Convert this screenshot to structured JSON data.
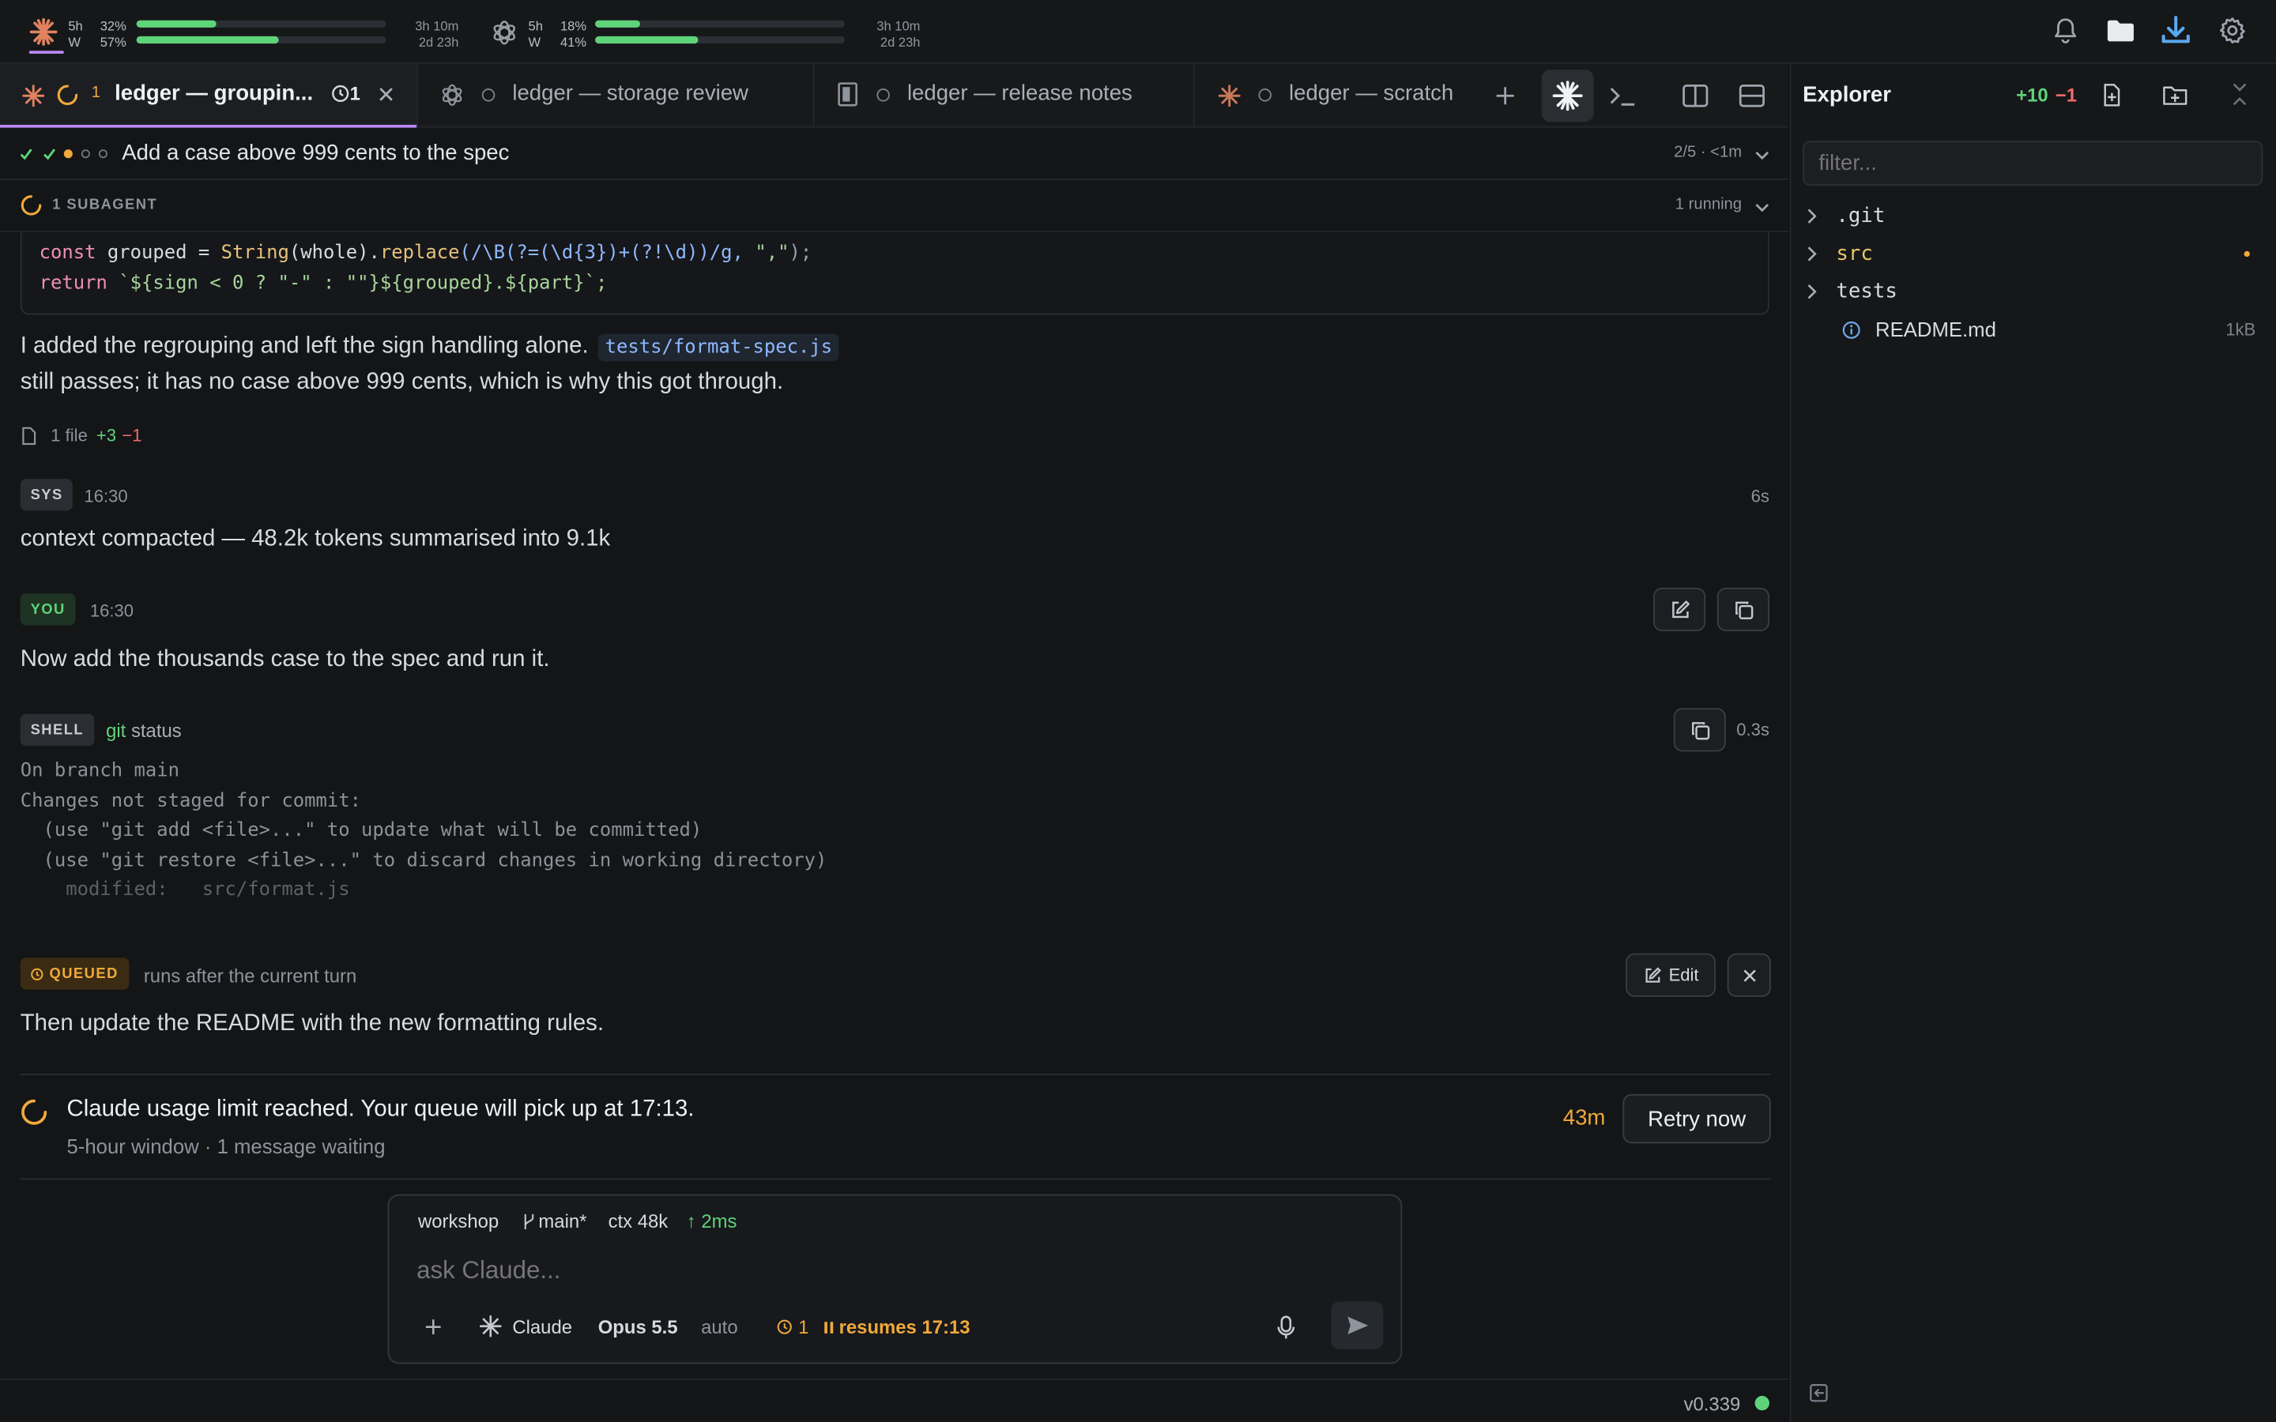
{
  "usage": [
    {
      "provider_icon": "claude-starburst-icon",
      "win1_label": "5h",
      "win2_label": "W",
      "pct1": "32%",
      "pct2": "57%",
      "fill1": 0.32,
      "fill2": 0.57,
      "time1": "3h 10m",
      "time2": "2d 23h"
    },
    {
      "provider_icon": "openai-knot-icon",
      "win1_label": "5h",
      "win2_label": "W",
      "pct1": "18%",
      "pct2": "41%",
      "fill1": 0.18,
      "fill2": 0.41,
      "time1": "3h 10m",
      "time2": "2d 23h"
    }
  ],
  "tabs": [
    {
      "title": "ledger — groupin...",
      "count": "1",
      "queue": "1",
      "active": true
    },
    {
      "title": "ledger — storage review"
    },
    {
      "title": "ledger — release notes"
    },
    {
      "title": "ledger — scratch"
    }
  ],
  "progress": {
    "title": "Add a case above 999 cents to the spec",
    "status": "2/5 · <1m"
  },
  "subagent": {
    "label": "1 SUBAGENT",
    "status": "1 running"
  },
  "code": {
    "line1": [
      "const",
      " grouped = ",
      "String",
      "(whole).",
      "replace",
      "(/\\B(?=(\\d{3})+(?!\\d))/g, ",
      "\",\"",
      ");"
    ],
    "line2": [
      "return",
      " `${sign < 0 ? \"-\" : \"\"}${grouped}.${part}`;"
    ]
  },
  "assistant": {
    "text_before": "I added the regrouping and left the sign handling alone.",
    "file_chip": "tests/format-spec.js",
    "text_after": "still passes; it has no case above 999 cents, which is why this got through.",
    "files": "1 file",
    "added": "+3",
    "removed": "−1"
  },
  "sys": {
    "badge": "SYS",
    "time": "16:30",
    "duration": "6s",
    "text": "context compacted — 48.2k tokens summarised into 9.1k"
  },
  "you": {
    "badge": "YOU",
    "time": "16:30",
    "text": "Now add the thousands case to the spec and run it."
  },
  "shell": {
    "badge": "SHELL",
    "cmd": "git",
    "arg": "status",
    "duration": "0.3s",
    "output": [
      "On branch main",
      "Changes not staged for commit:",
      "  (use \"git add <file>...\" to update what will be committed)",
      "  (use \"git restore <file>...\" to discard changes in working directory)",
      "    modified:   src/format.js"
    ]
  },
  "queued": {
    "badge": "QUEUED",
    "note": "runs after the current turn",
    "edit": "Edit",
    "text": "Then update the README with the new formatting rules."
  },
  "limit": {
    "title": "Claude usage limit reached. Your queue will pick up at 17:13.",
    "sub": "5-hour window · 1 message waiting",
    "countdown": "43m",
    "retry": "Retry now"
  },
  "composer": {
    "workspace": "workshop",
    "branch": "main*",
    "ctx": "ctx 48k",
    "latency": "↑ 2ms",
    "placeholder": "ask Claude...",
    "agent": "Claude",
    "model": "Opus 5.5",
    "mode": "auto",
    "queue": "1",
    "resumes": "resumes 17:13"
  },
  "explorer": {
    "title": "Explorer",
    "added": "+10",
    "removed": "−1",
    "filter_placeholder": "filter...",
    "items": [
      {
        "name": ".git",
        "type": "folder"
      },
      {
        "name": "src",
        "type": "folder",
        "modified": true
      },
      {
        "name": "tests",
        "type": "folder"
      },
      {
        "name": "README.md",
        "type": "file",
        "size": "1kB"
      }
    ]
  },
  "status": {
    "version": "v0.339"
  },
  "colors": {
    "accent": "#b987f5",
    "green": "#5fd37a",
    "amber": "#f0a93b",
    "red": "#f06b6b",
    "blue_chip": "#8fb8ff"
  }
}
